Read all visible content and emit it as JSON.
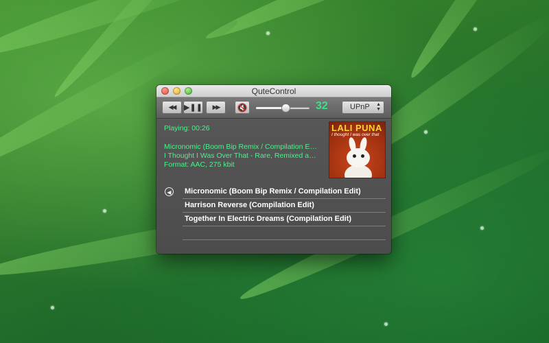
{
  "window": {
    "title": "QuteControl"
  },
  "toolbar": {
    "prev_icon": "◀◀",
    "play_pause_icon": "▶❚❚",
    "next_icon": "▶▶",
    "mute_icon": "🔇",
    "volume_level": 0.55,
    "volume_value": "32",
    "source_label": "UPnP"
  },
  "now_playing": {
    "status": "Playing: 00:26",
    "title": "Micronomic (Boom Bip Remix / Compilation Edit)",
    "album": "I Thought I Was Over That - Rare, Remixed and B-Sides",
    "format": "Format: AAC, 275 kbit"
  },
  "album_art": {
    "band": "LALI PUNA",
    "subtitle": "I thought I was over that"
  },
  "playlist": {
    "back_icon": "◀",
    "tracks": [
      "Micronomic (Boom Bip Remix / Compilation Edit)",
      "Harrison Reverse (Compilation Edit)",
      "Together In Electric Dreams (Compilation Edit)"
    ]
  },
  "colors": {
    "accent": "#4df08c"
  }
}
